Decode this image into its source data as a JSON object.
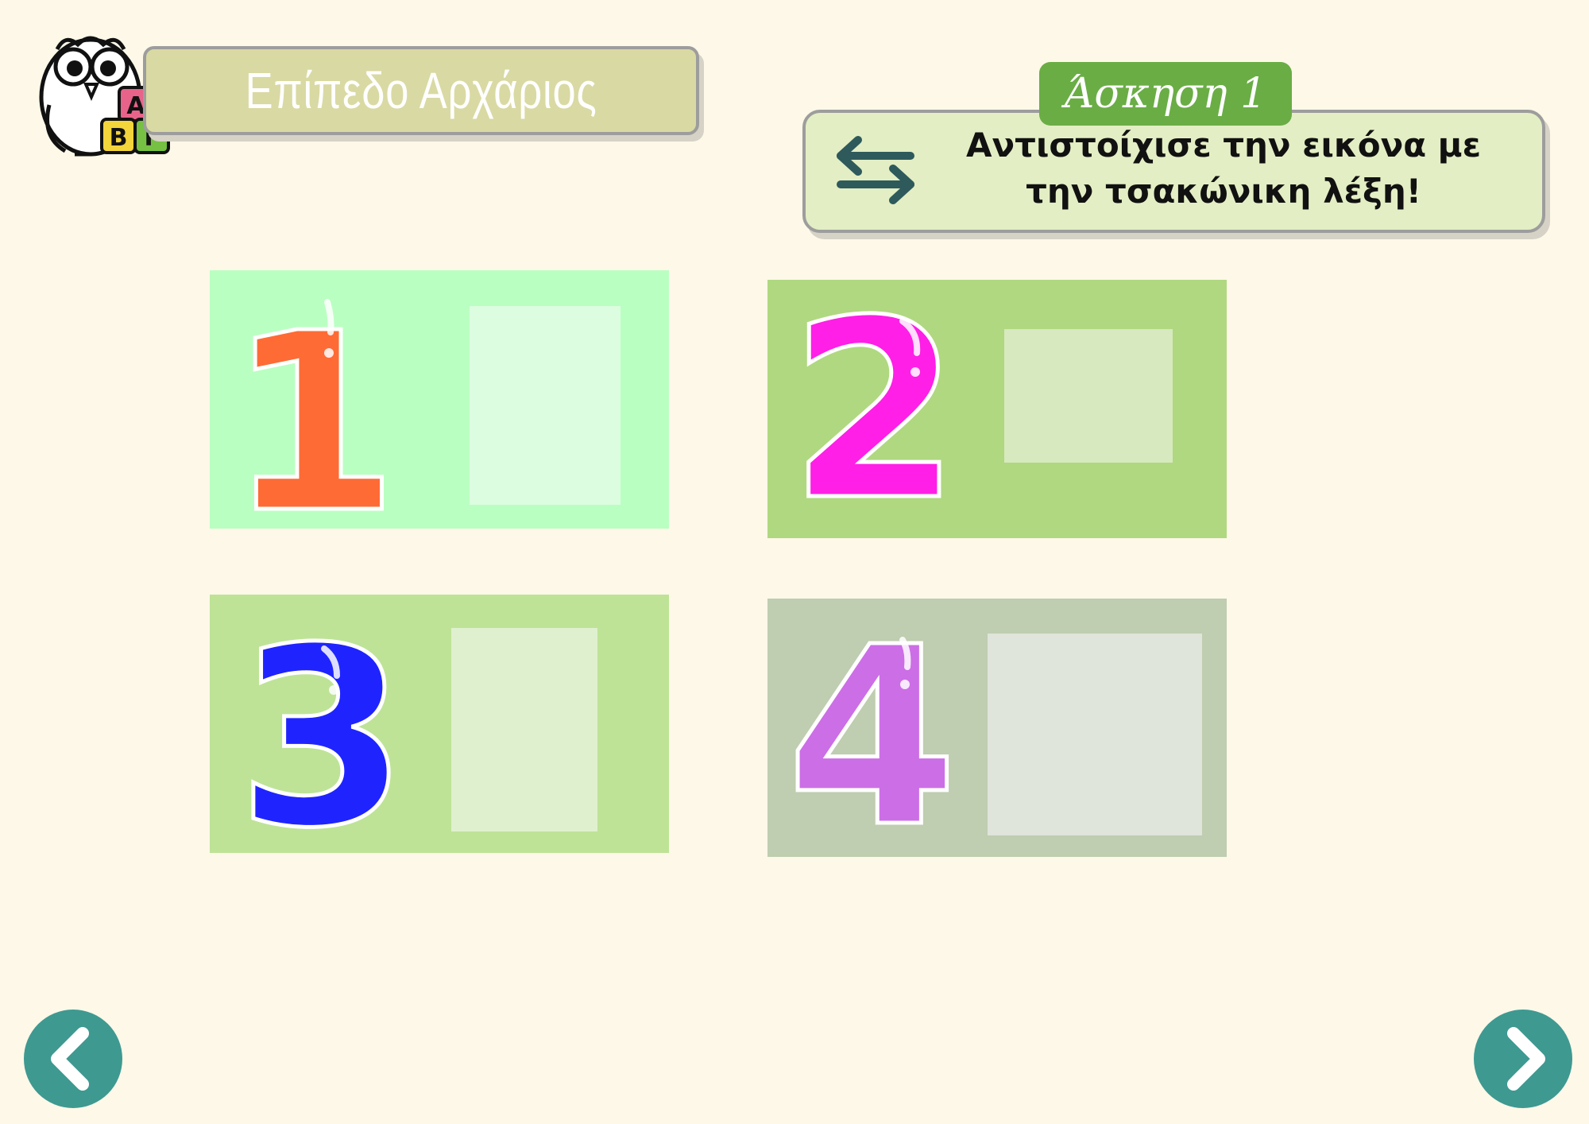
{
  "header": {
    "level_title": "Επίπεδο Αρχάριος",
    "owl_blocks": [
      "Α",
      "Β",
      "Γ"
    ]
  },
  "exercise": {
    "label": "Άσκηση 1",
    "instruction": "Αντιστοίχισε την εικόνα με την τσακώνικη λέξη!",
    "icon": "swap-arrows-icon"
  },
  "cards": [
    {
      "number": "1",
      "digit_color": "#ff6b35",
      "card_color": "#baffc2",
      "slot_color": "#dcfde0"
    },
    {
      "number": "2",
      "digit_color": "#ff1fe6",
      "card_color": "#b0d880",
      "slot_color": "#d7e9bf"
    },
    {
      "number": "3",
      "digit_color": "#1f24ff",
      "card_color": "#bee397",
      "slot_color": "#dff0cf"
    },
    {
      "number": "4",
      "digit_color": "#cc6ee6",
      "card_color": "#bfcdb0",
      "slot_color": "#dfe5da"
    }
  ],
  "navigation": {
    "previous": "chevron-left-icon",
    "next": "chevron-right-icon",
    "color": "#3e9991"
  }
}
